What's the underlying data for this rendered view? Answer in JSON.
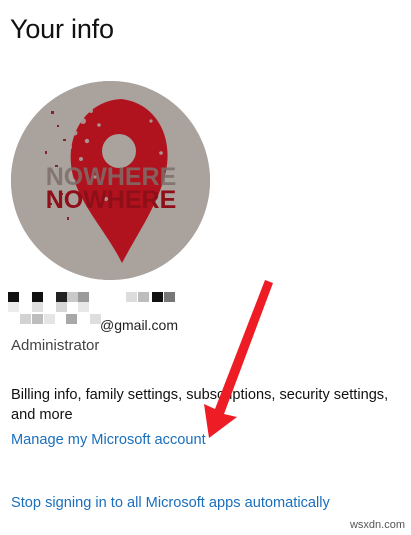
{
  "page": {
    "title": "Your info"
  },
  "account": {
    "avatar_text_line1": "NOWHERE",
    "avatar_text_line2": "NOWHERE",
    "email_suffix": "@gmail.com",
    "role": "Administrator"
  },
  "links": {
    "billing_text": "Billing info, family settings, subscriptions, security settings, and more",
    "manage_account": "Manage my Microsoft account",
    "stop_signing_in": "Stop signing in to all Microsoft apps automatically"
  },
  "watermark": "wsxdn.com",
  "colors": {
    "link": "#1a6fbd",
    "avatar_bg": "#aaa29d",
    "pin_red": "#b0131e",
    "annotation_arrow": "#ee1c24"
  },
  "icons": {
    "avatar_pin": "map-pin-icon",
    "annotation": "red-arrow-annotation"
  }
}
